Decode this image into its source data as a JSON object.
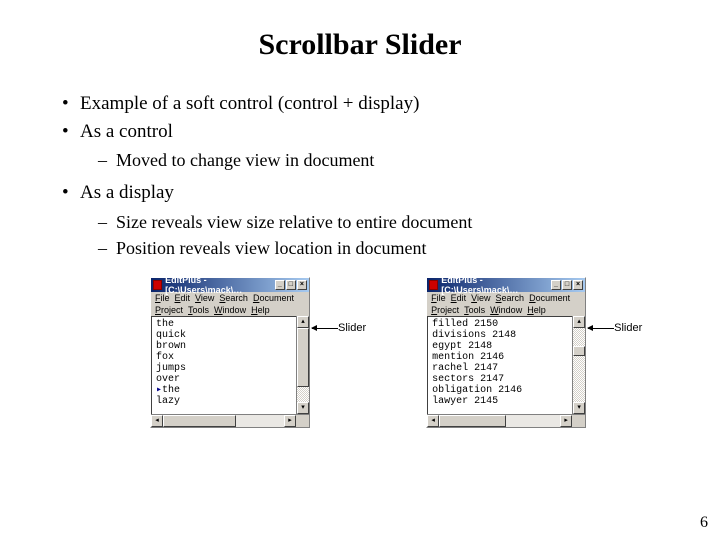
{
  "title": "Scrollbar Slider",
  "bullets": {
    "b1": "Example of a soft control (control + display)",
    "b2": "As a control",
    "b2_sub1": "Moved to change view in document",
    "b3": "As a display",
    "b3_sub1": "Size reveals view size relative to entire document",
    "b3_sub2": "Position reveals view location in document"
  },
  "window": {
    "title": "EditPlus - [C:\\Users\\mack\\…",
    "menu1": {
      "file": "File",
      "edit": "Edit",
      "view": "View",
      "search": "Search",
      "document": "Document"
    },
    "menu2": {
      "project": "Project",
      "tools": "Tools",
      "window": "Window",
      "help": "Help"
    }
  },
  "doc1_lines": [
    "the",
    "quick",
    "brown",
    "fox",
    "jumps",
    "over",
    "the",
    "lazy"
  ],
  "doc2_lines": [
    "filled 2150",
    "divisions 2148",
    "egypt 2148",
    "mention 2146",
    "rachel 2147",
    "sectors 2147",
    "obligation 2146",
    "lawyer 2145"
  ],
  "callout_label": "Slider",
  "page_number": "6"
}
